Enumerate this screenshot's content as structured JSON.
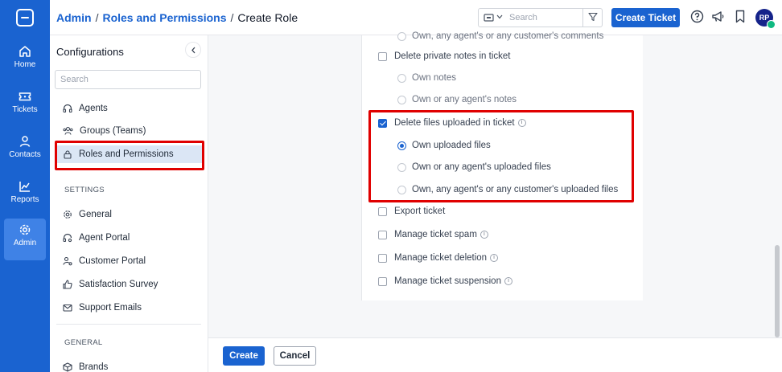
{
  "nav": {
    "items": [
      {
        "label": "Home"
      },
      {
        "label": "Tickets"
      },
      {
        "label": "Contacts"
      },
      {
        "label": "Reports"
      },
      {
        "label": "Admin"
      }
    ]
  },
  "header": {
    "breadcrumb": [
      "Admin",
      "Roles and Permissions",
      "Create Role"
    ],
    "search_placeholder": "Search",
    "create_ticket_label": "Create Ticket",
    "avatar_initials": "RP"
  },
  "config": {
    "title": "Configurations",
    "search_placeholder": "Search",
    "items": [
      {
        "label": "Agents"
      },
      {
        "label": "Groups (Teams)"
      },
      {
        "label": "Roles and Permissions"
      }
    ],
    "settings_title": "SETTINGS",
    "settings_items": [
      {
        "label": "General"
      },
      {
        "label": "Agent Portal"
      },
      {
        "label": "Customer Portal"
      },
      {
        "label": "Satisfaction Survey"
      },
      {
        "label": "Support Emails"
      }
    ],
    "general_title": "GENERAL",
    "general_items": [
      {
        "label": "Brands"
      }
    ]
  },
  "permissions": {
    "top_cut": "Own, any agent's or any customer's comments",
    "delete_notes": {
      "label": "Delete private notes in ticket",
      "checked": false
    },
    "notes_options": [
      "Own notes",
      "Own or any agent's notes"
    ],
    "delete_files": {
      "label": "Delete files uploaded in ticket",
      "checked": true
    },
    "files_options": [
      "Own uploaded files",
      "Own or any agent's uploaded files",
      "Own, any agent's or any customer's uploaded files"
    ],
    "files_selected": 0,
    "other": [
      {
        "label": "Export ticket",
        "info": false
      },
      {
        "label": "Manage ticket spam",
        "info": true
      },
      {
        "label": "Manage ticket deletion",
        "info": true
      },
      {
        "label": "Manage ticket suspension",
        "info": true
      }
    ]
  },
  "footer": {
    "create_label": "Create",
    "cancel_label": "Cancel"
  },
  "colors": {
    "brand": "#1a63d0",
    "highlight": "#e00000"
  }
}
